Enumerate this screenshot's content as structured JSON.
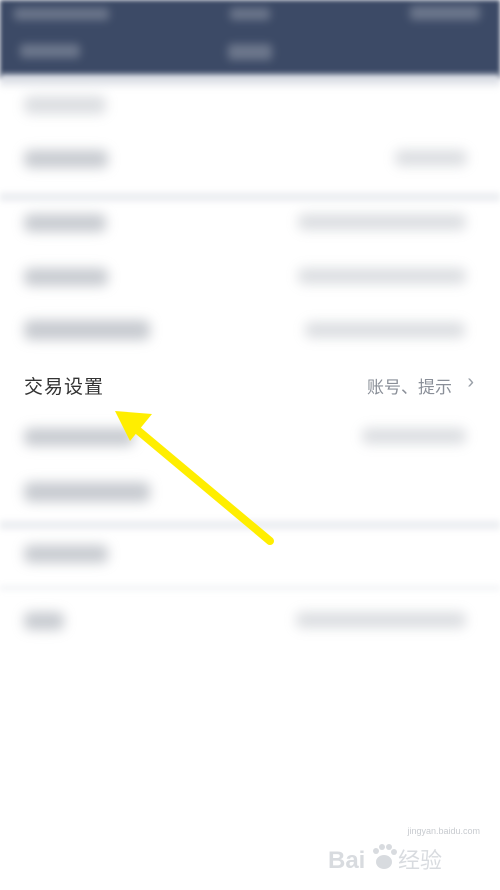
{
  "setting_row": {
    "label": "交易设置",
    "value": "账号、提示",
    "chevron": "›"
  },
  "annotation": {
    "arrow_color": "#ffee00",
    "icon": "arrow-pointer"
  },
  "watermark": {
    "brand": "Baidu经验",
    "site": "jingyan.baidu.com",
    "icon": "paw-logo"
  },
  "colors": {
    "header_bg": "#3c4a66",
    "row_label": "#333333",
    "row_value": "#8a8f98"
  }
}
